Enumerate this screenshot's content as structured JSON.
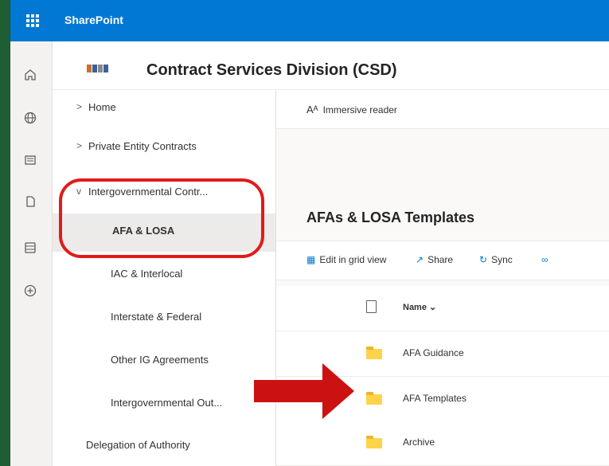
{
  "app": {
    "name": "SharePoint"
  },
  "site": {
    "title": "Contract Services Division (CSD)"
  },
  "rail_icons": [
    "home-icon",
    "globe-icon",
    "news-icon",
    "file-icon",
    "list-icon",
    "add-icon"
  ],
  "nav": {
    "items": [
      {
        "label": "Home",
        "chevron": ">"
      },
      {
        "label": "Private Entity Contracts",
        "chevron": ">"
      },
      {
        "label": "Intergovernmental Contr...",
        "chevron": "v"
      },
      {
        "label": "AFA & LOSA"
      },
      {
        "label": "IAC & Interlocal"
      },
      {
        "label": "Interstate & Federal"
      },
      {
        "label": "Other IG Agreements"
      },
      {
        "label": "Intergovernmental Out..."
      },
      {
        "label": "Delegation of Authority"
      }
    ]
  },
  "command": {
    "immersive_reader": "Immersive reader",
    "reader_glyph": "Aᴬ"
  },
  "library": {
    "title": "AFAs & LOSA Templates",
    "commands": {
      "edit_grid": "Edit in grid view",
      "share": "Share",
      "sync": "Sync"
    },
    "column_name": "Name",
    "sort_glyph": "⌄",
    "rows": [
      "AFA Guidance",
      "AFA Templates",
      "Archive"
    ]
  },
  "colors": {
    "brand": "#0078d4",
    "annotation": "#e11b1b",
    "arrow": "#cc1111",
    "background": "#1e5e34"
  }
}
